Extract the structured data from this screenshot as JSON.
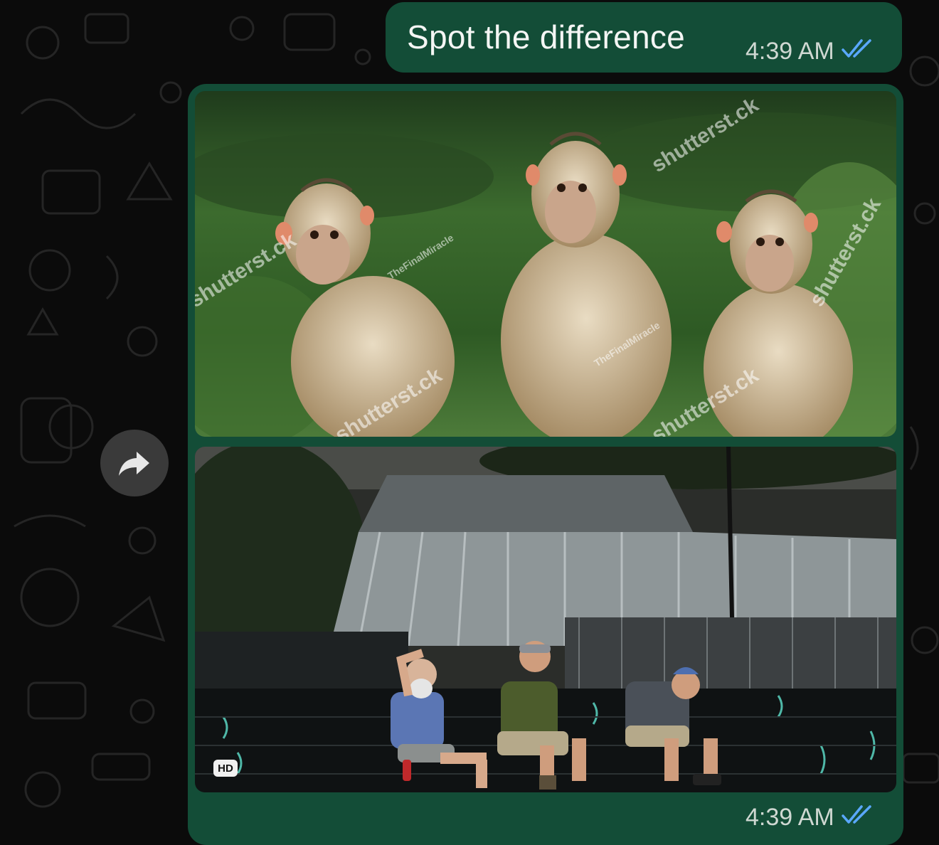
{
  "chat": {
    "message_text": "Spot the difference",
    "message_time": "4:39 AM",
    "media_time": "4:39 AM",
    "hd_badge": "HD"
  },
  "media": {
    "image1": {
      "watermarks": [
        "shutterst.ck",
        "shutterst.ck",
        "shutterst.ck",
        "shutterst.ck",
        "shutterst.ck"
      ],
      "credits": [
        "TheFinalMiracle",
        "TheFinalMiracle"
      ]
    }
  },
  "colors": {
    "bubble": "#134d37",
    "background": "#0b0b0b",
    "read_ticks": "#5aa8ff"
  },
  "icons": {
    "forward": "forward-arrow-icon",
    "read_receipt": "double-check-icon"
  }
}
